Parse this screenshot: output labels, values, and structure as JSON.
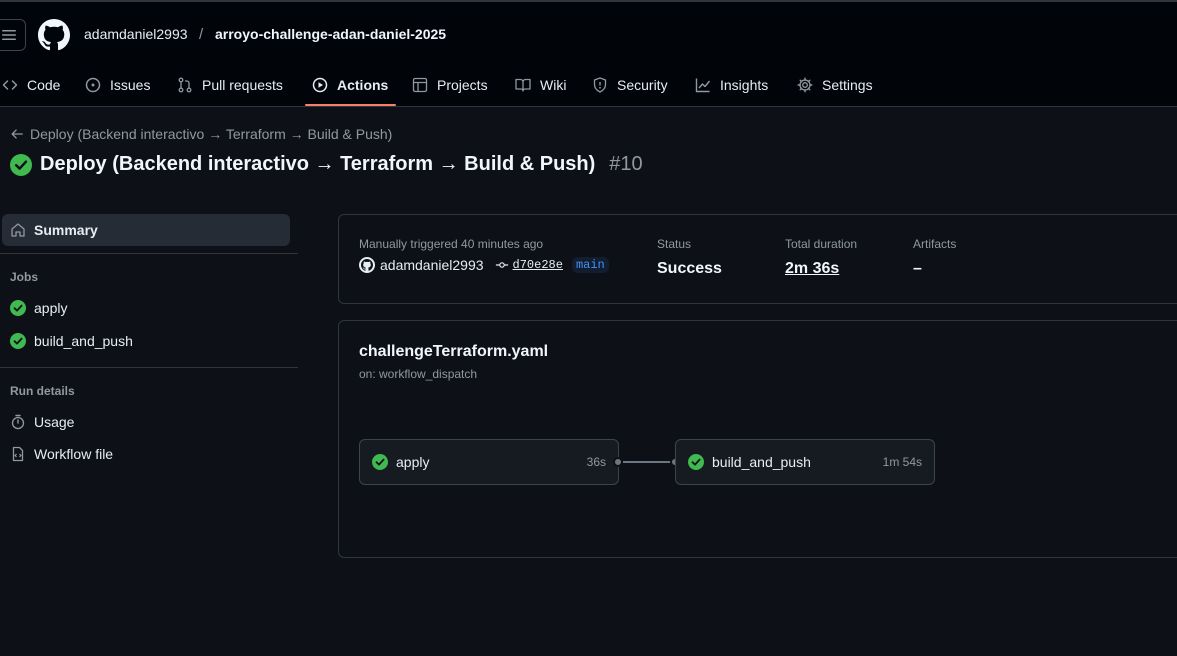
{
  "header": {
    "owner": "adamdaniel2993",
    "separator": "/",
    "repo": "arroyo-challenge-adan-daniel-2025"
  },
  "nav": {
    "tabs": [
      {
        "label": "Code",
        "icon": "code-icon"
      },
      {
        "label": "Issues",
        "icon": "issue-opened-icon"
      },
      {
        "label": "Pull requests",
        "icon": "git-pull-request-icon"
      },
      {
        "label": "Actions",
        "icon": "play-icon",
        "active": true
      },
      {
        "label": "Projects",
        "icon": "table-icon"
      },
      {
        "label": "Wiki",
        "icon": "book-icon"
      },
      {
        "label": "Security",
        "icon": "shield-icon"
      },
      {
        "label": "Insights",
        "icon": "graph-icon"
      },
      {
        "label": "Settings",
        "icon": "gear-icon"
      }
    ]
  },
  "run": {
    "back_label": "Deploy (Backend interactivo → Terraform → Build & Push)",
    "title": "Deploy (Backend interactivo → Terraform → Build & Push)",
    "number": "#10"
  },
  "sidebar": {
    "summary": "Summary",
    "jobs_heading": "Jobs",
    "jobs": [
      "apply",
      "build_and_push"
    ],
    "details_heading": "Run details",
    "usage": "Usage",
    "workflow_file": "Workflow file"
  },
  "summary": {
    "trigger": "Manually triggered 40 minutes ago",
    "actor": "adamdaniel2993",
    "commit": "d70e28e",
    "branch": "main",
    "status_label": "Status",
    "status_value": "Success",
    "duration_label": "Total duration",
    "duration_value": "2m 36s",
    "artifacts_label": "Artifacts",
    "artifacts_value": "–"
  },
  "workflow": {
    "file": "challengeTerraform.yaml",
    "trigger": "on: workflow_dispatch",
    "jobs": [
      {
        "name": "apply",
        "duration": "36s"
      },
      {
        "name": "build_and_push",
        "duration": "1m 54s"
      }
    ]
  },
  "colors": {
    "success": "#3fb950",
    "accent_underline": "#f78166",
    "background": "#0d1117"
  }
}
